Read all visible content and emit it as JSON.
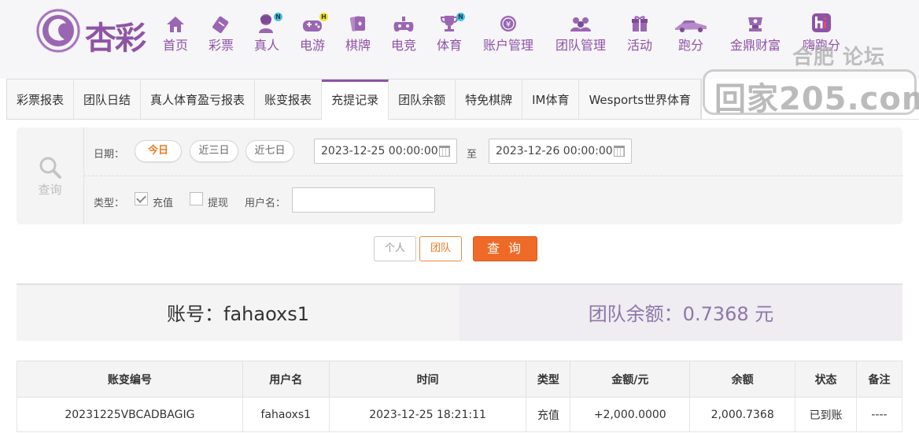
{
  "brand": {
    "logo_text": "杏彩",
    "color": "#8e54a6"
  },
  "nav": [
    {
      "label": "首页",
      "icon": "home-icon"
    },
    {
      "label": "彩票",
      "icon": "lottery-ticket-icon"
    },
    {
      "label": "真人",
      "icon": "dealer-icon",
      "badge": "N"
    },
    {
      "label": "电游",
      "icon": "gamepad-icon",
      "badge": "H"
    },
    {
      "label": "棋牌",
      "icon": "cards-icon"
    },
    {
      "label": "电竞",
      "icon": "controller-icon"
    },
    {
      "label": "体育",
      "icon": "trophy-icon",
      "badge": "N"
    },
    {
      "label": "账户管理",
      "icon": "account-coin-icon"
    },
    {
      "label": "团队管理",
      "icon": "team-icon"
    },
    {
      "label": "活动",
      "icon": "gift-icon"
    },
    {
      "label": "跑分",
      "icon": "race-car-icon"
    },
    {
      "label": "金鼎财富",
      "icon": "wealth-icon"
    },
    {
      "label": "嗨跑分",
      "icon": "hi-icon"
    }
  ],
  "watermark": {
    "top": "合肥 论坛",
    "main": "回家205.com"
  },
  "tabs": [
    {
      "label": "彩票报表",
      "active": false
    },
    {
      "label": "团队日结",
      "active": false
    },
    {
      "label": "真人体育盈亏报表",
      "active": false
    },
    {
      "label": "账变报表",
      "active": false
    },
    {
      "label": "充提记录",
      "active": true
    },
    {
      "label": "团队余额",
      "active": false
    },
    {
      "label": "特免棋牌",
      "active": false
    },
    {
      "label": "IM体育",
      "active": false
    },
    {
      "label": "Wesports世界体育",
      "active": false
    }
  ],
  "filter": {
    "search_label": "查询",
    "date_label": "日期：",
    "quick_ranges": [
      "今日",
      "近三日",
      "近七日"
    ],
    "active_range": "今日",
    "start_date": "2023-12-25 00:00:00",
    "to_label": "至",
    "end_date": "2023-12-26 00:00:00",
    "type_label": "类型：",
    "type_deposit": "充值",
    "type_withdraw": "提现",
    "deposit_checked": true,
    "withdraw_checked": false,
    "username_label": "用户名：",
    "username_value": ""
  },
  "buttons": {
    "person": "个人",
    "team": "团队",
    "query": "查 询"
  },
  "summary": {
    "account": "账号：fahaoxs1",
    "team_balance": "团队余额：0.7368 元"
  },
  "table": {
    "headers": [
      "账变编号",
      "用户名",
      "时间",
      "类型",
      "金额/元",
      "余额",
      "状态",
      "备注"
    ],
    "rows": [
      [
        "20231225VBCADBAGIG",
        "fahaoxs1",
        "2023-12-25 18:21:11",
        "充值",
        "+2,000.0000",
        "2,000.7368",
        "已到账",
        "----"
      ]
    ]
  },
  "colors": {
    "accent": "#8e54a6",
    "orange": "#ee6a26",
    "success": "#4e9a21"
  }
}
